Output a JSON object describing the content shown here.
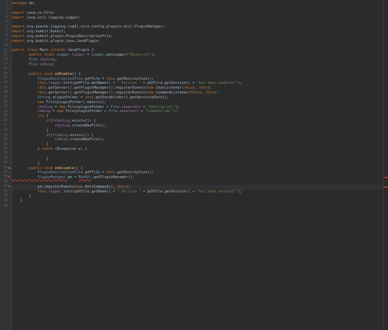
{
  "colors": {
    "background": "#2b2b2b",
    "gutter": "#313335",
    "keyword": "#cc7832",
    "string": "#6a8759",
    "field": "#9876aa",
    "method": "#ffc66d",
    "text": "#a9b7c6",
    "error": "#bc3f3c"
  },
  "editor": {
    "lines": [
      {
        "n": "1",
        "tokens": [
          {
            "t": "package ",
            "c": "kw"
          },
          {
            "t": "kp;",
            "c": ""
          }
        ]
      },
      {
        "n": "2",
        "tokens": []
      },
      {
        "n": "3",
        "tokens": [
          {
            "t": "import ",
            "c": "kw"
          },
          {
            "t": "java.io.File;",
            "c": ""
          }
        ]
      },
      {
        "n": "4",
        "tokens": [
          {
            "t": "import ",
            "c": "kw"
          },
          {
            "t": "java.util.logging.Logger;",
            "c": ""
          }
        ]
      },
      {
        "n": "5",
        "tokens": []
      },
      {
        "n": "6",
        "tokens": [
          {
            "t": "import ",
            "c": "kw"
          },
          {
            "t": "org.apache.logging.log4j.core.config.plugins.util.PluginManager;",
            "c": ""
          }
        ]
      },
      {
        "n": "7",
        "tokens": [
          {
            "t": "import ",
            "c": "kw"
          },
          {
            "t": "org.bukkit.Bukkit;",
            "c": ""
          }
        ]
      },
      {
        "n": "8",
        "tokens": [
          {
            "t": "import ",
            "c": "kw"
          },
          {
            "t": "org.bukkit.plugin.PluginDescriptionFile;",
            "c": ""
          }
        ]
      },
      {
        "n": "9",
        "tokens": [
          {
            "t": "import ",
            "c": "kw"
          },
          {
            "t": "org.bukkit.plugin.java.JavaPlugin;",
            "c": ""
          }
        ]
      },
      {
        "n": "10",
        "tokens": []
      },
      {
        "n": "11",
        "tokens": [
          {
            "t": "public class ",
            "c": "kw"
          },
          {
            "t": "Main ",
            "c": ""
          },
          {
            "t": "extends ",
            "c": "kw"
          },
          {
            "t": "JavaPlugin ",
            "c": ""
          },
          {
            "t": "{",
            "c": ""
          }
        ]
      },
      {
        "n": "12",
        "tokens": [
          {
            "t": "        public final ",
            "c": "kw"
          },
          {
            "t": "Logger ",
            "c": "cls"
          },
          {
            "t": "logger",
            "c": "fld"
          },
          {
            "t": " = ",
            "c": ""
          },
          {
            "t": "Logger",
            "c": "cls"
          },
          {
            "t": ".getLogger(",
            "c": ""
          },
          {
            "t": "\"Minecraft\"",
            "c": "str"
          },
          {
            "t": ");",
            "c": ""
          }
        ]
      },
      {
        "n": "13",
        "tokens": [
          {
            "t": "        File ",
            "c": "cls"
          },
          {
            "t": "chatLog",
            "c": "fld"
          },
          {
            "t": ";",
            "c": ""
          }
        ]
      },
      {
        "n": "14",
        "tokens": [
          {
            "t": "        File ",
            "c": "cls"
          },
          {
            "t": "cmdLog",
            "c": "fld"
          },
          {
            "t": ";",
            "c": ""
          }
        ]
      },
      {
        "n": "15",
        "tokens": []
      },
      {
        "n": "16",
        "tokens": [
          {
            "t": "        public void ",
            "c": "kw"
          },
          {
            "t": "onEnable",
            "c": "mth"
          },
          {
            "t": "() {",
            "c": ""
          }
        ]
      },
      {
        "n": "17",
        "tokens": [
          {
            "t": "            PluginDescriptionFile ",
            "c": "cls"
          },
          {
            "t": "pdfFile = ",
            "c": ""
          },
          {
            "t": "this",
            "c": "kw"
          },
          {
            "t": ".getDescription();",
            "c": ""
          }
        ]
      },
      {
        "n": "18",
        "tokens": [
          {
            "t": "            this",
            "c": "kw"
          },
          {
            "t": ".",
            "c": ""
          },
          {
            "t": "logger",
            "c": "fld"
          },
          {
            "t": ".info(pdfFile.getName() + ",
            "c": ""
          },
          {
            "t": "\" Version \"",
            "c": "str"
          },
          {
            "t": " + pdfFile.getVersion() + ",
            "c": ""
          },
          {
            "t": "\"has been enabled!\"",
            "c": "str"
          },
          {
            "t": ");",
            "c": ""
          }
        ]
      },
      {
        "n": "19",
        "tokens": [
          {
            "t": "            this",
            "c": "kw"
          },
          {
            "t": ".getServer().getPluginManager().registerEvents(",
            "c": ""
          },
          {
            "t": "new ",
            "c": "kw"
          },
          {
            "t": "ChatListener(",
            "c": ""
          },
          {
            "t": "this",
            "c": "kw"
          },
          {
            "t": "), ",
            "c": ""
          },
          {
            "t": "this",
            "c": "kw"
          },
          {
            "t": ");",
            "c": ""
          }
        ]
      },
      {
        "n": "20",
        "tokens": [
          {
            "t": "            this",
            "c": "kw"
          },
          {
            "t": ".getServer().getPluginManager().registerEvents(",
            "c": ""
          },
          {
            "t": "new ",
            "c": "kw"
          },
          {
            "t": "CommandListener(",
            "c": ""
          },
          {
            "t": "this",
            "c": "kw"
          },
          {
            "t": "), ",
            "c": ""
          },
          {
            "t": "this",
            "c": "kw"
          },
          {
            "t": ");",
            "c": ""
          }
        ]
      },
      {
        "n": "21",
        "tokens": [
          {
            "t": "            String ",
            "c": "cls"
          },
          {
            "t": "pluginFolder = ",
            "c": ""
          },
          {
            "t": "this",
            "c": "kw"
          },
          {
            "t": ".getDataFolder().getAbsolutePath();",
            "c": ""
          }
        ]
      },
      {
        "n": "22",
        "tokens": [
          {
            "t": "            new ",
            "c": "kw"
          },
          {
            "t": "File(pluginFolder).mkdirs();",
            "c": ""
          }
        ]
      },
      {
        "n": "23",
        "tokens": [
          {
            "t": "            chatLog",
            "c": "fld"
          },
          {
            "t": " = ",
            "c": ""
          },
          {
            "t": "new ",
            "c": "kw"
          },
          {
            "t": "File(pluginFolder + ",
            "c": ""
          },
          {
            "t": "File",
            "c": "cls"
          },
          {
            "t": ".",
            "c": ""
          },
          {
            "t": "separator",
            "c": "fld"
          },
          {
            "t": " + ",
            "c": ""
          },
          {
            "t": "\"Chatlog.yml\"",
            "c": "str"
          },
          {
            "t": ");",
            "c": ""
          }
        ]
      },
      {
        "n": "24",
        "tokens": [
          {
            "t": "            cmdLog",
            "c": "fld"
          },
          {
            "t": " = ",
            "c": ""
          },
          {
            "t": "new ",
            "c": "kw"
          },
          {
            "t": "File(pluginFolder + ",
            "c": ""
          },
          {
            "t": "File",
            "c": "cls"
          },
          {
            "t": ".",
            "c": ""
          },
          {
            "t": "separator",
            "c": "fld"
          },
          {
            "t": " + ",
            "c": ""
          },
          {
            "t": "\"Command.yml\"",
            "c": "str"
          },
          {
            "t": ");",
            "c": ""
          }
        ]
      },
      {
        "n": "25",
        "tokens": [
          {
            "t": "            try ",
            "c": "kw"
          },
          {
            "t": "{",
            "c": ""
          }
        ]
      },
      {
        "n": "26",
        "tokens": [
          {
            "t": "                if",
            "c": "kw"
          },
          {
            "t": "(!",
            "c": ""
          },
          {
            "t": "chatLog",
            "c": "fld"
          },
          {
            "t": ".exists()) {",
            "c": ""
          }
        ]
      },
      {
        "n": "27",
        "tokens": [
          {
            "t": "                    chatLog",
            "c": "fld"
          },
          {
            "t": ".createNewFile();",
            "c": ""
          }
        ]
      },
      {
        "n": "28",
        "tokens": [
          {
            "t": "                }",
            "c": ""
          }
        ]
      },
      {
        "n": "29",
        "tokens": [
          {
            "t": "                if",
            "c": "kw"
          },
          {
            "t": "(!",
            "c": ""
          },
          {
            "t": "cmdLog",
            "c": "fld"
          },
          {
            "t": ".exists()) {",
            "c": ""
          }
        ]
      },
      {
        "n": "30",
        "tokens": [
          {
            "t": "                    cmdLog",
            "c": "fld"
          },
          {
            "t": ".createNewFile();",
            "c": ""
          }
        ]
      },
      {
        "n": "31",
        "tokens": [
          {
            "t": "                }",
            "c": ""
          }
        ]
      },
      {
        "n": "32",
        "tokens": [
          {
            "t": "            } ",
            "c": ""
          },
          {
            "t": "catch ",
            "c": "kw"
          },
          {
            "t": "(Exception e) {",
            "c": ""
          }
        ]
      },
      {
        "n": "33",
        "tokens": []
      },
      {
        "n": "34",
        "tokens": [
          {
            "t": "                }",
            "c": ""
          }
        ]
      },
      {
        "n": "35",
        "tokens": [
          {
            "t": "            }",
            "c": ""
          }
        ]
      },
      {
        "n": "36",
        "tokens": [
          {
            "t": "        public void ",
            "c": "kw"
          },
          {
            "t": "onDisable",
            "c": "mth"
          },
          {
            "t": "() {",
            "c": ""
          }
        ]
      },
      {
        "n": "37",
        "tokens": [
          {
            "t": "            PluginDescriptionFile ",
            "c": "cls"
          },
          {
            "t": "pdfFile = ",
            "c": ""
          },
          {
            "t": "this",
            "c": "kw"
          },
          {
            "t": ".getDescription();",
            "c": ""
          }
        ]
      },
      {
        "n": "38",
        "tokens": [
          {
            "t": "            PluginManager ",
            "c": "cls"
          },
          {
            "t": "pm = ",
            "c": ""
          },
          {
            "t": "Bukkit",
            "c": "cls"
          },
          {
            "t": ".getPluginManager();",
            "c": ""
          }
        ]
      },
      {
        "n": "39",
        "tokens": []
      },
      {
        "n": "40",
        "tokens": [
          {
            "t": "            pm.registerEvents(",
            "c": ""
          },
          {
            "t": "new ",
            "c": "kw"
          },
          {
            "t": "AntiCommand(), ",
            "c": ""
          },
          {
            "t": "this",
            "c": "kw"
          },
          {
            "t": ");",
            "c": ""
          }
        ]
      },
      {
        "n": "41",
        "tokens": [
          {
            "t": "            this",
            "c": "kw"
          },
          {
            "t": ".",
            "c": ""
          },
          {
            "t": "logger",
            "c": "fld"
          },
          {
            "t": ".info(pdfFile.getName() + ",
            "c": ""
          },
          {
            "t": "\" Version \"",
            "c": "str"
          },
          {
            "t": " + pdfFile.getVersion() + ",
            "c": ""
          },
          {
            "t": "\"has been enabled!\"",
            "c": "str"
          },
          {
            "t": ");",
            "c": ""
          }
        ]
      },
      {
        "n": "42",
        "tokens": [
          {
            "t": "        }",
            "c": ""
          }
        ]
      },
      {
        "n": "43",
        "tokens": [
          {
            "t": "    }",
            "c": ""
          }
        ]
      },
      {
        "n": "44",
        "tokens": []
      }
    ],
    "gutter_icons": {
      "15": "fold-icon",
      "36": "override-icon",
      "37": "fold-icon",
      "38": "error-icon",
      "40": "error-icon"
    },
    "current_line": "40",
    "error_lines": [
      "38",
      "40"
    ]
  }
}
